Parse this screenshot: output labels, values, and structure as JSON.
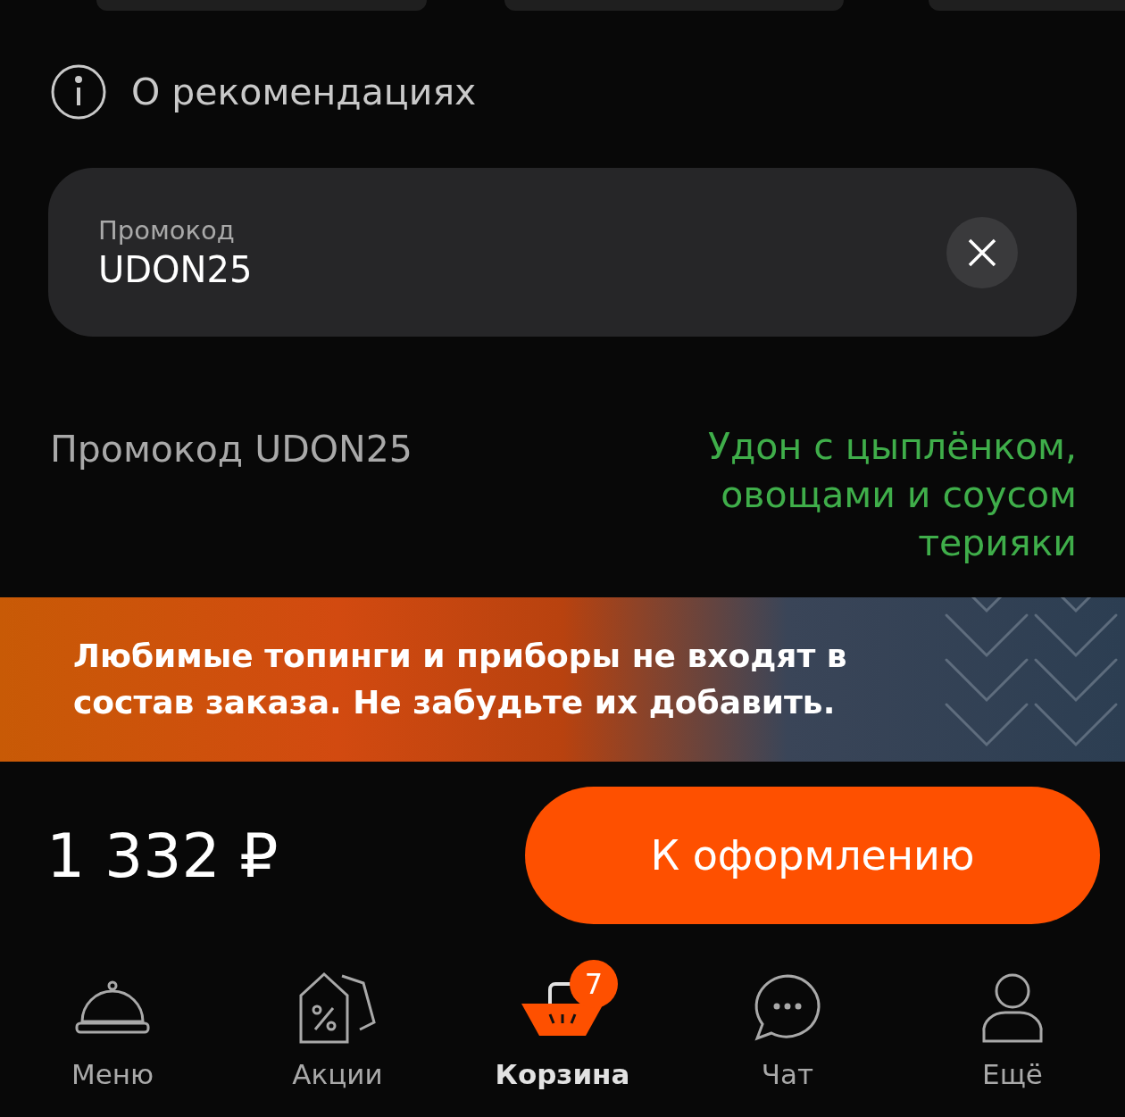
{
  "info_link": "О рекомендациях",
  "promo_field": {
    "label": "Промокод",
    "value": "UDON25"
  },
  "promo_result": {
    "code_text": "Промокод UDON25",
    "gift_text": "Удон с цыплёнком, овощами и соусом терияки"
  },
  "banner": {
    "text": "Любимые топинги и приборы не входят в состав заказа. Не забудьте их добавить."
  },
  "checkout": {
    "total": "1 332 ₽",
    "button": "К оформлению"
  },
  "nav": [
    {
      "kind": "menu",
      "label": "Меню",
      "selected": false
    },
    {
      "kind": "promo",
      "label": "Акции",
      "selected": false
    },
    {
      "kind": "cart",
      "label": "Корзина",
      "selected": true,
      "badge": "7"
    },
    {
      "kind": "chat",
      "label": "Чат",
      "selected": false
    },
    {
      "kind": "more",
      "label": "Ещё",
      "selected": false
    }
  ]
}
